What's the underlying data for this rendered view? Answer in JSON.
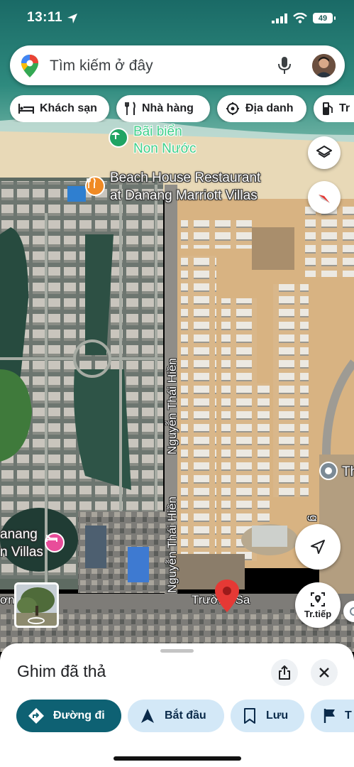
{
  "status_bar": {
    "time": "13:11",
    "battery": "49"
  },
  "search": {
    "placeholder": "Tìm kiếm ở đây"
  },
  "chips": [
    {
      "label": "Khách sạn",
      "icon": "bed-icon"
    },
    {
      "label": "Nhà hàng",
      "icon": "restaurant-icon"
    },
    {
      "label": "Địa danh",
      "icon": "landmark-icon"
    },
    {
      "label": "Tr",
      "icon": "gas-station-icon"
    }
  ],
  "map": {
    "beach_name_line1": "Bãi biển",
    "beach_name_line2": "Non Nước",
    "restaurant_line1": "Beach House Restaurant",
    "restaurant_line2": "at Danang Marriott Villas",
    "street_vertical_1": "Nguyễn Thái Hiền",
    "street_vertical_2": "Nguyễn Thái Hiền",
    "street_horizontal": "Trường Sa",
    "hotel_line1": "anang",
    "hotel_line2": "n Villas",
    "edge_street_left": "ơn",
    "edge_poi_right": "Th",
    "edge_street_right": "g"
  },
  "buttons": {
    "live_view_label": "Tr.tiếp"
  },
  "sheet": {
    "title": "Ghim đã thả",
    "actions": [
      {
        "label": "Đường đi",
        "icon": "directions-icon"
      },
      {
        "label": "Bắt đầu",
        "icon": "navigation-arrow-icon"
      },
      {
        "label": "Lưu",
        "icon": "bookmark-icon"
      },
      {
        "label": "T",
        "icon": "flag-icon"
      }
    ]
  },
  "colors": {
    "primary_button": "#0e6173",
    "secondary_button": "#d3e8f7",
    "pin": "#e53935",
    "hotel_pin": "#e84d9a",
    "restaurant_pin": "#f08a24",
    "beach_pin": "#1fa463"
  }
}
